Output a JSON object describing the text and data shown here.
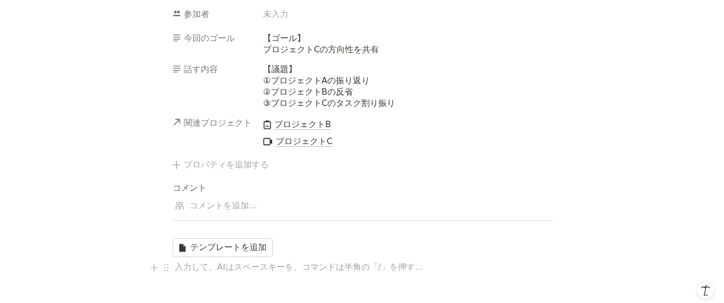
{
  "properties": [
    {
      "kind": "people",
      "label": "参加者",
      "empty": "未入力"
    },
    {
      "kind": "text",
      "label": "今回のゴール",
      "lines": [
        "【ゴール】",
        "プロジェクトCの方向性を共有"
      ]
    },
    {
      "kind": "text",
      "label": "話す内容",
      "lines": [
        "【議題】",
        "①プロジェクトAの振り返り",
        "②プロジェクトBの反省",
        "③プロジェクトCのタスク割り振り"
      ]
    },
    {
      "kind": "relation",
      "label": "関連プロジェクト",
      "pages": [
        {
          "kind": "clipboard",
          "title": "プロジェクトB"
        },
        {
          "kind": "video",
          "title": "プロジェクトC"
        }
      ]
    }
  ],
  "add_property": "プロパティを追加する",
  "comments": {
    "heading": "コメント",
    "placeholder": "コメントを追加..."
  },
  "template_button": "テンプレートを追加",
  "editor": {
    "placeholder": "入力して、AIはスペースキーを、コマンドは半角の「/」を押す..."
  }
}
